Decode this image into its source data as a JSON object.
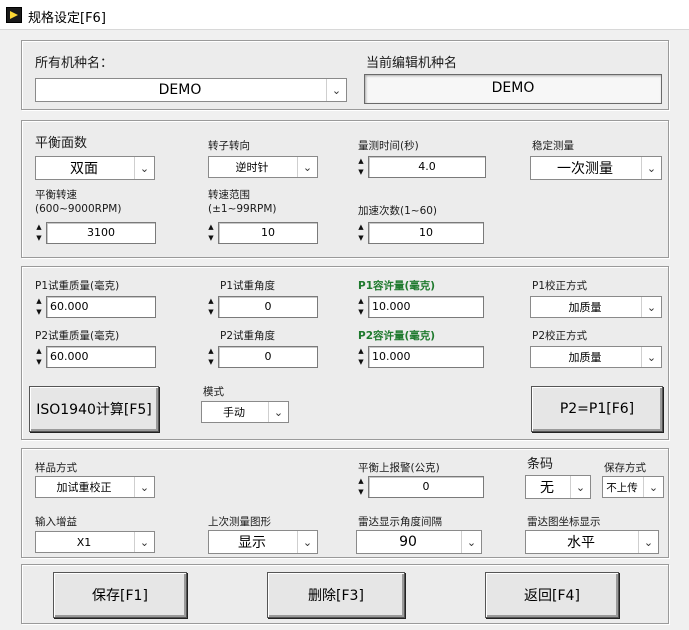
{
  "window": {
    "title": "规格设定[F6]"
  },
  "model": {
    "all_label": "所有机种名：",
    "all_value": "DEMO",
    "current_label": "当前编辑机种名",
    "current_value": "DEMO"
  },
  "balance": {
    "plane_label": "平衡面数",
    "plane_value": "双面",
    "rotation_label": "转子转向",
    "rotation_value": "逆时针",
    "measure_time_label": "量测时间(秒)",
    "measure_time_value": "4.0",
    "stable_label": "稳定测量",
    "stable_value": "一次测量",
    "speed_label_1": "平衡转速",
    "speed_label_2": "(600~9000RPM)",
    "speed_value": "3100",
    "speed_range_label_1": "转速范围",
    "speed_range_label_2": "(±1~99RPM)",
    "speed_range_value": "10",
    "accel_label": "加速次数(1~60)",
    "accel_value": "10"
  },
  "trial": {
    "p1_mass_label": "P1试重质量(毫克)",
    "p1_mass_value": "60.000",
    "p1_angle_label": "P1试重角度",
    "p1_angle_value": "0",
    "p1_tol_label": "P1容许量(毫克)",
    "p1_tol_value": "10.000",
    "p1_correct_label": "P1校正方式",
    "p1_correct_value": "加质量",
    "p2_mass_label": "P2试重质量(毫克)",
    "p2_mass_value": "60.000",
    "p2_angle_label": "P2试重角度",
    "p2_angle_value": "0",
    "p2_tol_label": "P2容许量(毫克)",
    "p2_tol_value": "10.000",
    "p2_correct_label": "P2校正方式",
    "p2_correct_value": "加质量",
    "iso_button": "ISO1940计算[F5]",
    "mode_label": "模式",
    "mode_value": "手动",
    "copy_button": "P2=P1[F6]"
  },
  "misc": {
    "sample_label": "样品方式",
    "sample_value": "加试重校正",
    "alarm_label": "平衡上报警(公克)",
    "alarm_value": "0",
    "barcode_label": "条码",
    "barcode_value": "无",
    "save_mode_label": "保存方式",
    "save_mode_value": "不上传",
    "gain_label": "输入增益",
    "gain_value": "X1",
    "last_graph_label": "上次测量图形",
    "last_graph_value": "显示",
    "radar_angle_label": "雷达显示角度间隔",
    "radar_angle_value": "90",
    "radar_coord_label": "雷达图坐标显示",
    "radar_coord_value": "水平"
  },
  "footer": {
    "save_button": "保存[F1]",
    "delete_button": "删除[F3]",
    "back_button": "返回[F4]"
  }
}
